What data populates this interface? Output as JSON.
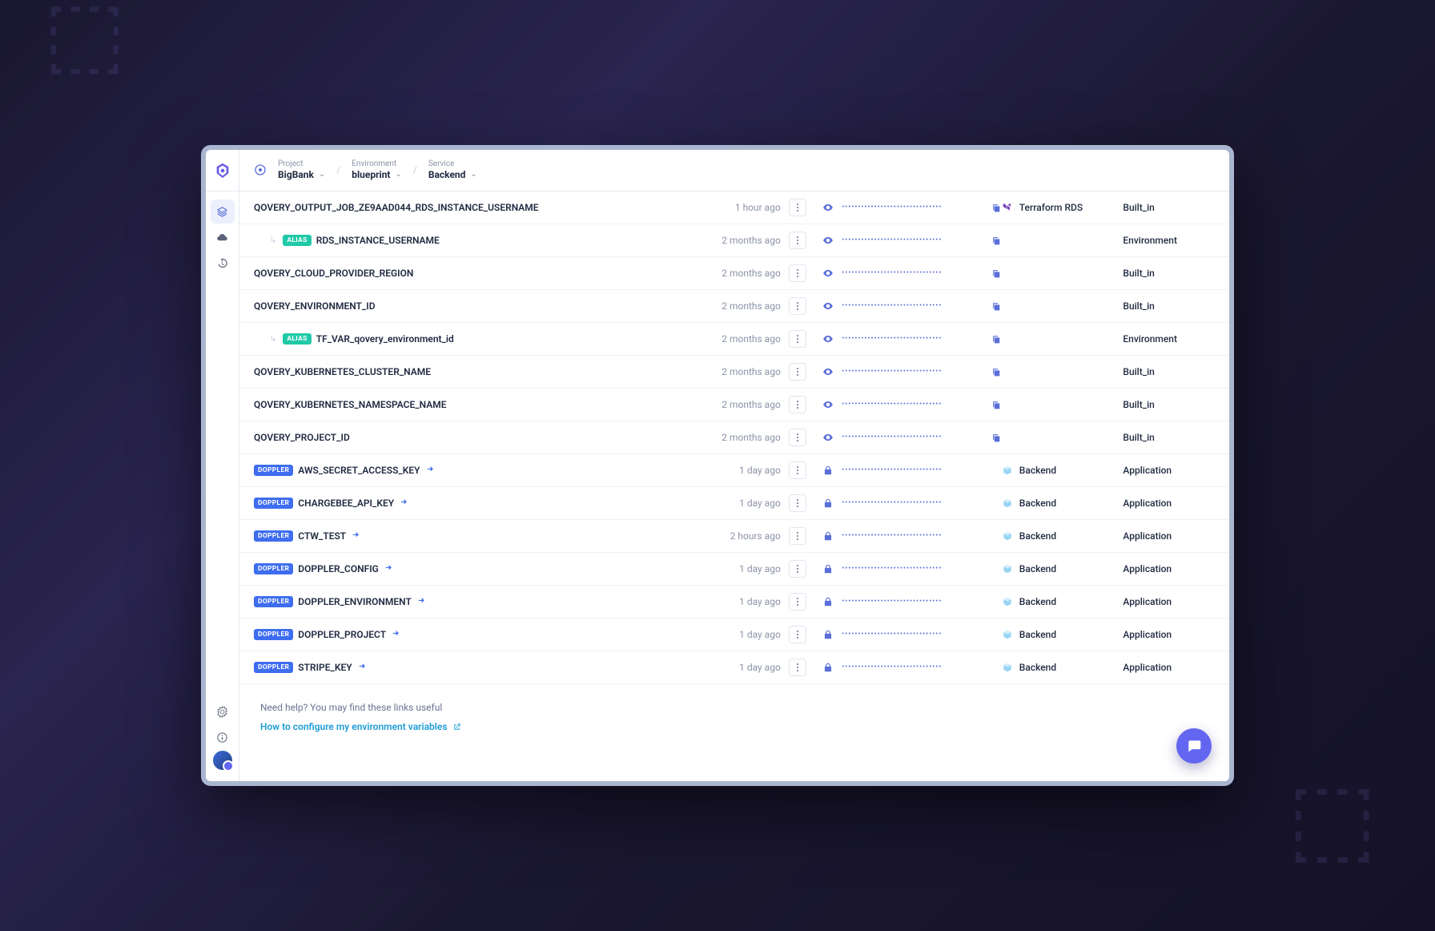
{
  "breadcrumb": {
    "project_label": "Project",
    "project_value": "BigBank",
    "env_label": "Environment",
    "env_value": "blueprint",
    "service_label": "Service",
    "service_value": "Backend"
  },
  "rows": [
    {
      "name": "QOVERY_OUTPUT_JOB_ZE9AAD044_RDS_INSTANCE_USERNAME",
      "time": "1 hour ago",
      "secret": false,
      "service": "Terraform RDS",
      "svc_kind": "tf",
      "scope": "Built_in",
      "copy": true
    },
    {
      "name": "RDS_INSTANCE_USERNAME",
      "time": "2 months ago",
      "badge": "ALIAS",
      "indent": true,
      "secret": false,
      "service": "",
      "scope": "Environment",
      "copy": true
    },
    {
      "name": "QOVERY_CLOUD_PROVIDER_REGION",
      "time": "2 months ago",
      "secret": false,
      "service": "",
      "scope": "Built_in",
      "copy": true
    },
    {
      "name": "QOVERY_ENVIRONMENT_ID",
      "time": "2 months ago",
      "secret": false,
      "service": "",
      "scope": "Built_in",
      "copy": true
    },
    {
      "name": "TF_VAR_qovery_environment_id",
      "time": "2 months ago",
      "badge": "ALIAS",
      "indent": true,
      "secret": false,
      "service": "",
      "scope": "Environment",
      "copy": true
    },
    {
      "name": "QOVERY_KUBERNETES_CLUSTER_NAME",
      "time": "2 months ago",
      "secret": false,
      "service": "",
      "scope": "Built_in",
      "copy": true
    },
    {
      "name": "QOVERY_KUBERNETES_NAMESPACE_NAME",
      "time": "2 months ago",
      "secret": false,
      "service": "",
      "scope": "Built_in",
      "copy": true
    },
    {
      "name": "QOVERY_PROJECT_ID",
      "time": "2 months ago",
      "secret": false,
      "service": "",
      "scope": "Built_in",
      "copy": true
    },
    {
      "name": "AWS_SECRET_ACCESS_KEY",
      "time": "1 day ago",
      "badge": "DOPPLER",
      "link": true,
      "secret": true,
      "service": "Backend",
      "svc_kind": "app",
      "scope": "Application"
    },
    {
      "name": "CHARGEBEE_API_KEY",
      "time": "1 day ago",
      "badge": "DOPPLER",
      "link": true,
      "secret": true,
      "service": "Backend",
      "svc_kind": "app",
      "scope": "Application"
    },
    {
      "name": "CTW_TEST",
      "time": "2 hours ago",
      "badge": "DOPPLER",
      "link": true,
      "secret": true,
      "service": "Backend",
      "svc_kind": "app",
      "scope": "Application"
    },
    {
      "name": "DOPPLER_CONFIG",
      "time": "1 day ago",
      "badge": "DOPPLER",
      "link": true,
      "secret": true,
      "service": "Backend",
      "svc_kind": "app",
      "scope": "Application"
    },
    {
      "name": "DOPPLER_ENVIRONMENT",
      "time": "1 day ago",
      "badge": "DOPPLER",
      "link": true,
      "secret": true,
      "service": "Backend",
      "svc_kind": "app",
      "scope": "Application"
    },
    {
      "name": "DOPPLER_PROJECT",
      "time": "1 day ago",
      "badge": "DOPPLER",
      "link": true,
      "secret": true,
      "service": "Backend",
      "svc_kind": "app",
      "scope": "Application"
    },
    {
      "name": "STRIPE_KEY",
      "time": "1 day ago",
      "badge": "DOPPLER",
      "link": true,
      "secret": true,
      "service": "Backend",
      "svc_kind": "app",
      "scope": "Application"
    }
  ],
  "footer": {
    "question": "Need help? You may find these links useful",
    "link_text": "How to configure my environment variables"
  },
  "masked": "•••••••••••••••••••••••••••••••"
}
